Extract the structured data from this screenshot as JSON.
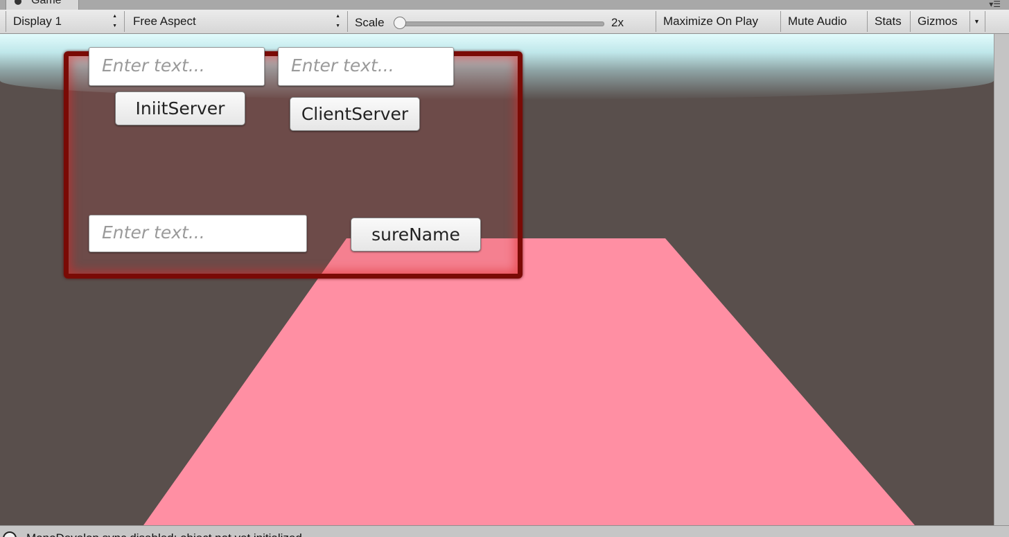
{
  "window": {
    "tab_title": "Game",
    "panel_menu_glyph": "▾☰"
  },
  "toolbar": {
    "display_label": "Display 1",
    "aspect_label": "Free Aspect",
    "scale_label": "Scale",
    "scale_value_label": "2x",
    "scale_slider_level": 0.0,
    "maximize_label": "Maximize On Play",
    "mute_label": "Mute Audio",
    "stats_label": "Stats",
    "gizmos_label": "Gizmos",
    "updown_glyph_up": "▲",
    "updown_glyph_down": "▼",
    "dropdown_glyph": "▼"
  },
  "game_ui": {
    "input1_placeholder": "Enter text...",
    "input2_placeholder": "Enter text...",
    "input3_placeholder": "Enter text...",
    "init_server_label": "IniitServer",
    "client_server_label": "ClientServer",
    "surename_label": "sureName"
  },
  "scene": {
    "plane_color": "#ff8fa3",
    "ground_color": "#594f4c",
    "sky_color": "#e2fbfc",
    "panel_border_color": "#7a0a05"
  },
  "statusbar": {
    "message": "MonoDevelop sync disabled: object not yet initialized..."
  }
}
